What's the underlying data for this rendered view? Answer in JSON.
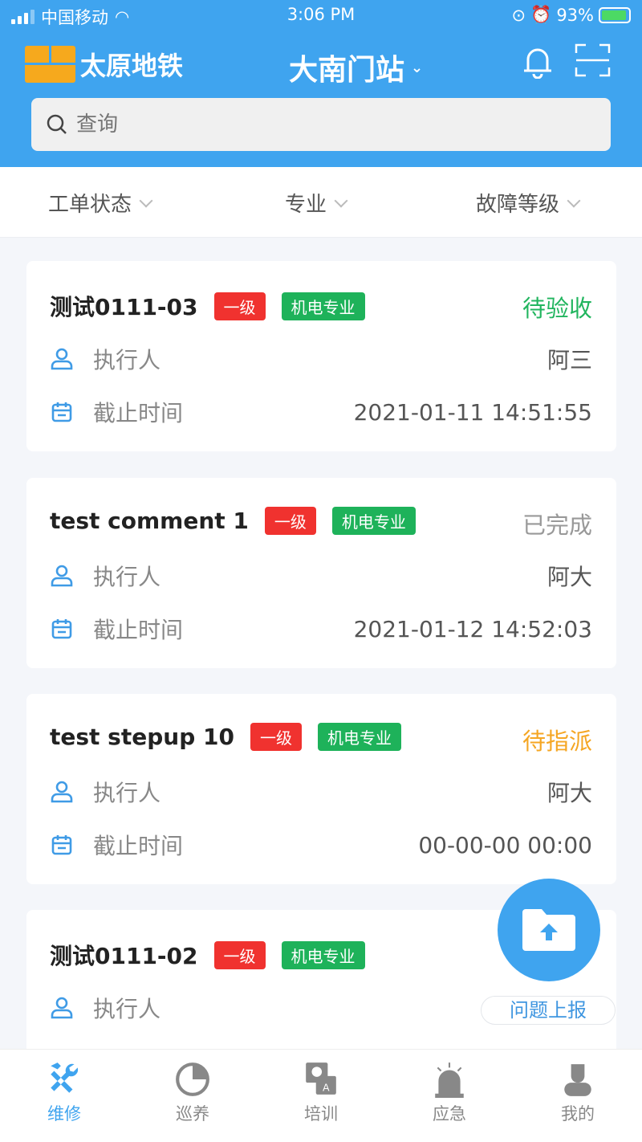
{
  "status_bar": {
    "carrier": "中国移动",
    "time": "3:06 PM",
    "battery": "93%",
    "battery_level": 0.93
  },
  "header": {
    "logo_text": "太原地铁",
    "station": "大南门站",
    "icons": [
      "bell-icon",
      "scan-icon"
    ]
  },
  "search": {
    "placeholder": "查询"
  },
  "filters": [
    {
      "label": "工单状态"
    },
    {
      "label": "专业"
    },
    {
      "label": "故障等级"
    }
  ],
  "labels": {
    "executor": "执行人",
    "deadline": "截止时间"
  },
  "colors": {
    "primary": "#3fa4ef",
    "level_tag": "#f0322f",
    "major_tag": "#1eb25a",
    "status_accept": "#22b55f",
    "status_done": "#999999",
    "status_assign": "#f5a623"
  },
  "orders": [
    {
      "title": "测试0111-03",
      "level": "一级",
      "major": "机电专业",
      "status": "待验收",
      "status_color": "#22b55f",
      "executor": "阿三",
      "deadline": "2021-01-11 14:51:55"
    },
    {
      "title": "test comment 1",
      "level": "一级",
      "major": "机电专业",
      "status": "已完成",
      "status_color": "#999999",
      "executor": "阿大",
      "deadline": "2021-01-12 14:52:03"
    },
    {
      "title": "test stepup 10",
      "level": "一级",
      "major": "机电专业",
      "status": "待指派",
      "status_color": "#f5a623",
      "executor": "阿大",
      "deadline": "00-00-00 00:00"
    },
    {
      "title": "测试0111-02",
      "level": "一级",
      "major": "机电专业"
    }
  ],
  "fab": {
    "label": "问题上报",
    "icon": "folder-upload-icon"
  },
  "nav": [
    {
      "label": "维修",
      "icon": "repair-icon",
      "active": true
    },
    {
      "label": "巡养",
      "icon": "patrol-icon"
    },
    {
      "label": "培训",
      "icon": "qa-icon"
    },
    {
      "label": "应急",
      "icon": "alarm-icon"
    },
    {
      "label": "我的",
      "icon": "user-icon"
    }
  ]
}
